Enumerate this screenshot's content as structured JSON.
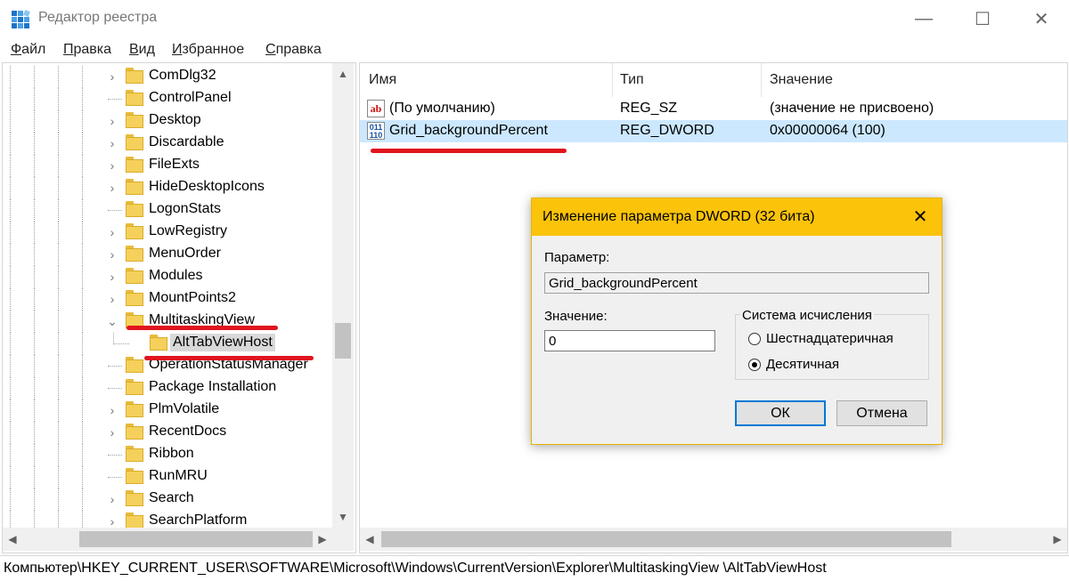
{
  "window": {
    "title": "Редактор реестра",
    "controls": {
      "minimize": "—",
      "maximize": "☐",
      "close": "✕"
    }
  },
  "menu": [
    {
      "key": "Ф",
      "rest": "айл"
    },
    {
      "key": "П",
      "rest": "равка"
    },
    {
      "key": "В",
      "rest": "ид"
    },
    {
      "key": "И",
      "rest": "збранное"
    },
    {
      "key": "С",
      "rest": "правка"
    }
  ],
  "tree": {
    "items": [
      {
        "label": "ComDlg32",
        "expander": "›"
      },
      {
        "label": "ControlPanel",
        "expander": ""
      },
      {
        "label": "Desktop",
        "expander": "›"
      },
      {
        "label": "Discardable",
        "expander": "›"
      },
      {
        "label": "FileExts",
        "expander": "›"
      },
      {
        "label": "HideDesktopIcons",
        "expander": "›"
      },
      {
        "label": "LogonStats",
        "expander": ""
      },
      {
        "label": "LowRegistry",
        "expander": "›"
      },
      {
        "label": "MenuOrder",
        "expander": "›"
      },
      {
        "label": "Modules",
        "expander": "›"
      },
      {
        "label": "MountPoints2",
        "expander": "›"
      },
      {
        "label": "MultitaskingView",
        "expander": "⌄"
      },
      {
        "label": "AltTabViewHost",
        "expander": ""
      },
      {
        "label": "OperationStatusManager",
        "expander": ""
      },
      {
        "label": "Package Installation",
        "expander": ""
      },
      {
        "label": "PlmVolatile",
        "expander": "›"
      },
      {
        "label": "RecentDocs",
        "expander": "›"
      },
      {
        "label": "Ribbon",
        "expander": ""
      },
      {
        "label": "RunMRU",
        "expander": ""
      },
      {
        "label": "Search",
        "expander": "›"
      },
      {
        "label": "SearchPlatform",
        "expander": "›"
      }
    ],
    "scroll": {
      "up": "▲",
      "down": "▼",
      "left": "◀",
      "right": "▶"
    }
  },
  "list": {
    "headers": {
      "name": "Имя",
      "type": "Тип",
      "value": "Значение"
    },
    "rows": [
      {
        "icon": "ab",
        "name": "(По умолчанию)",
        "type": "REG_SZ",
        "value": "(значение не присвоено)"
      },
      {
        "icon": "011\n110",
        "name": "Grid_backgroundPercent",
        "type": "REG_DWORD",
        "value": "0x00000064 (100)"
      }
    ],
    "scroll": {
      "left": "◀",
      "right": "▶"
    }
  },
  "status": {
    "path": "Компьютер\\HKEY_CURRENT_USER\\SOFTWARE\\Microsoft\\Windows\\CurrentVersion\\Explorer\\MultitaskingView \\AltTabViewHost"
  },
  "dialog": {
    "title": "Изменение параметра DWORD (32 бита)",
    "close": "✕",
    "param_label": "Параметр:",
    "param_value": "Grid_backgroundPercent",
    "value_label": "Значение:",
    "value_input": "0",
    "base_group": "Система исчисления",
    "radio_hex": "Шестнадцатеричная",
    "radio_dec": "Десятичная",
    "selected_base": "decimal",
    "ok": "ОК",
    "cancel": "Отмена"
  },
  "colors": {
    "dialog_title_bg": "#fbc30a",
    "selection_bg": "#cce8ff",
    "annotation_red": "#e0141e",
    "folder": "#f5d05a"
  }
}
